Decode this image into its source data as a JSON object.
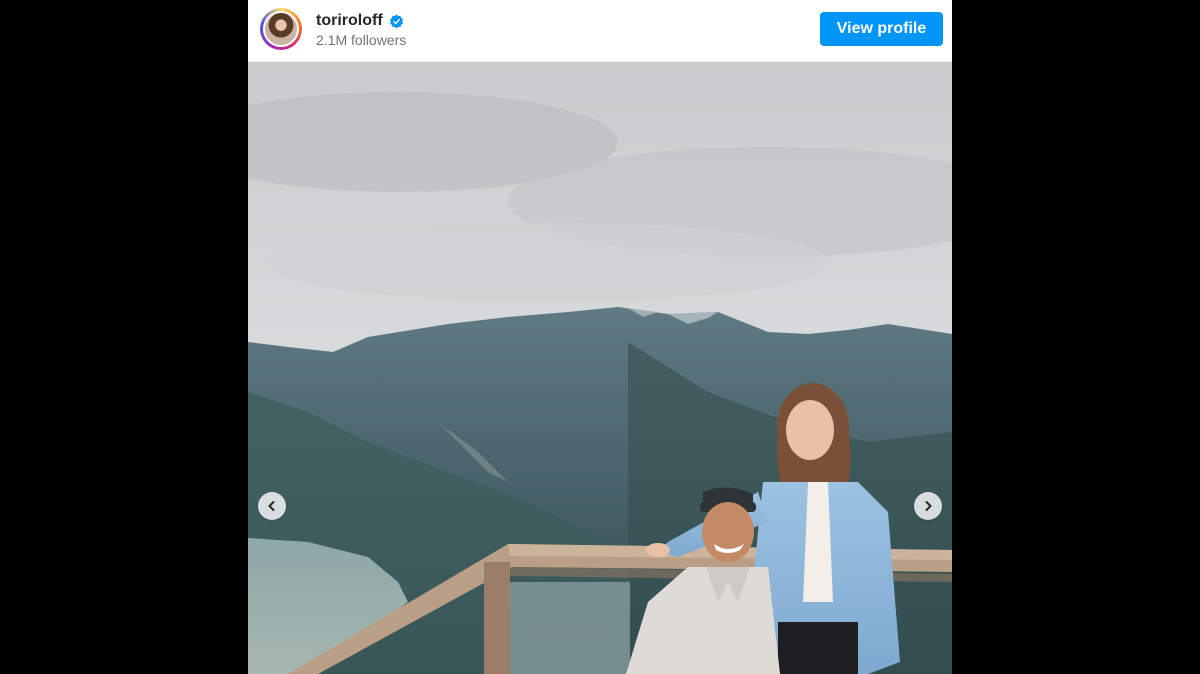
{
  "profile": {
    "username": "toriroloff",
    "followers": "2.1M followers",
    "verified_icon": "verified-badge-icon",
    "view_profile_label": "View profile"
  },
  "colors": {
    "accent": "#0095f6",
    "verified": "#0095f6",
    "username": "#262626",
    "secondary_text": "#737373"
  },
  "carousel": {
    "prev_icon": "chevron-left-icon",
    "next_icon": "chevron-right-icon"
  }
}
